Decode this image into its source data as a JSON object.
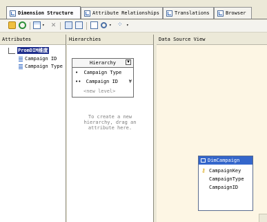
{
  "tabs": [
    {
      "label": "Dimension Structure",
      "icon": "dimension-structure-icon",
      "active": true
    },
    {
      "label": "Attribute Relationships",
      "icon": "attribute-relationships-icon",
      "active": false
    },
    {
      "label": "Translations",
      "icon": "translations-icon",
      "active": false
    },
    {
      "label": "Browser",
      "icon": "browser-icon",
      "active": false
    }
  ],
  "toolbar": {
    "icons": [
      "process-icon",
      "refresh-icon",
      "layout-icon",
      "dropdown-arrow-icon",
      "delete-icon",
      "show-table-icon",
      "hide-table-icon",
      "zoom-icon",
      "zoom-dropdown-arrow-icon",
      "arrange-icon",
      "arrange-dropdown-arrow-icon"
    ]
  },
  "attributes_pane": {
    "title": "Attributes",
    "dimension_name": "PromDIM维度",
    "items": [
      "Campaign ID",
      "Campaign Type"
    ]
  },
  "hierarchies_pane": {
    "title": "Hierarchies",
    "hierarchy": {
      "name": "Hierarchy",
      "levels": [
        "Campaign Type",
        "Campaign ID"
      ],
      "new_level": "<new level>"
    },
    "hint": [
      "To create a new",
      "hierarchy, drag an",
      "attribute here."
    ]
  },
  "dsv_pane": {
    "title": "Data Source View",
    "table": {
      "name": "DimCampaign",
      "columns": [
        "CampaignKey",
        "CampaignType",
        "CampaignID"
      ],
      "key_column": "CampaignKey"
    }
  },
  "colors": {
    "selection": "#1f2f8c",
    "table_header": "#3466cb",
    "dsv_background": "#fdf6e4",
    "chrome": "#ece9d8"
  }
}
